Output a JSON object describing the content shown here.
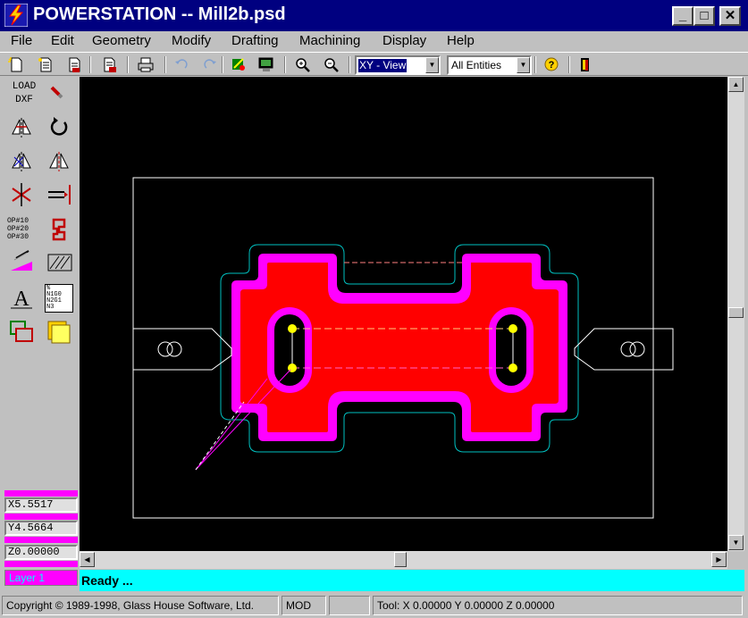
{
  "window": {
    "title": "POWERSTATION -- Mill2b.psd",
    "minimize_glyph": "_",
    "maximize_glyph": "□",
    "close_glyph": "✕"
  },
  "menu": [
    "File",
    "Edit",
    "Geometry",
    "Modify",
    "Drafting",
    "Machining",
    "Display",
    "Help"
  ],
  "toolbar": {
    "view_select": "XY - View",
    "entity_select": "All Entities",
    "help_glyph": "?",
    "icons": [
      "new-file-icon",
      "open-file-icon",
      "save-file-icon",
      "print-preview-icon",
      "print-icon",
      "undo-icon",
      "redo-icon",
      "regenerate-icon",
      "display-icon",
      "zoom-in-icon",
      "zoom-out-icon",
      "help-icon",
      "exit-icon"
    ]
  },
  "left_panel": {
    "load_dxf_line1": "LOAD",
    "load_dxf_line2": "DXF",
    "op_lines": [
      "OP#10",
      "OP#20",
      "OP#30"
    ],
    "text_tool_glyph": "A",
    "nc_lines": [
      "%",
      "N1G0",
      "N2G1",
      "N3"
    ],
    "coords": {
      "x": "X5.5517",
      "y": "Y4.5664",
      "z": "Z0.00000"
    },
    "layer_label": "Layer 1"
  },
  "status": {
    "message": "Ready ...",
    "copyright": "Copyright © 1989-1998, Glass House Software, Ltd.",
    "mode": "MOD",
    "tool_position": "Tool: X 0.00000 Y 0.00000 Z 0.00000"
  },
  "colors": {
    "title_bar": "#000080",
    "canvas": "#000000",
    "part_fill": "#ff0000",
    "toolpath": "#ff00ff",
    "status_bar": "#00ffff"
  }
}
